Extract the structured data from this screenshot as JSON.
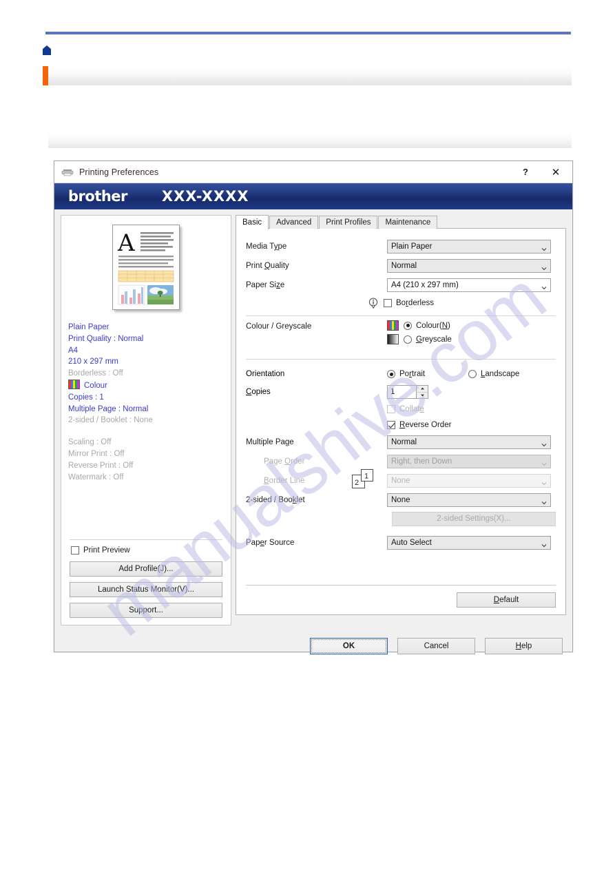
{
  "page": {
    "watermark": "manualshive.com",
    "home_icon": "home-icon"
  },
  "dialog": {
    "title": "Printing Preferences",
    "title_icon": "printer-icon",
    "help_btn": "?",
    "close_btn": "✕",
    "brand": "brother",
    "model": "XXX-XXXX"
  },
  "preview": {
    "summary": [
      {
        "text": "Plain Paper",
        "dim": false
      },
      {
        "text": "Print Quality : Normal",
        "dim": false
      },
      {
        "text": "A4",
        "dim": false
      },
      {
        "text": "210 x 297 mm",
        "dim": false
      },
      {
        "text": "Borderless : Off",
        "dim": true
      },
      {
        "text": "Colour",
        "dim": false,
        "swatch": true
      },
      {
        "text": "Copies : 1",
        "dim": false
      },
      {
        "text": "Multiple Page : Normal",
        "dim": false
      },
      {
        "text": "2-sided / Booklet : None",
        "dim": true
      },
      {
        "text": "",
        "dim": true,
        "gap": true
      },
      {
        "text": "Scaling : Off",
        "dim": true
      },
      {
        "text": "Mirror Print : Off",
        "dim": true
      },
      {
        "text": "Reverse Print : Off",
        "dim": true
      },
      {
        "text": "Watermark : Off",
        "dim": true
      }
    ],
    "print_preview_label": "Print Preview",
    "print_preview_checked": false,
    "buttons": [
      "Add Profile(J)...",
      "Launch Status Monitor(V)...",
      "Support..."
    ]
  },
  "tabs": [
    {
      "label": "Basic",
      "active": true
    },
    {
      "label": "Advanced",
      "active": false
    },
    {
      "label": "Print Profiles",
      "active": false
    },
    {
      "label": "Maintenance",
      "active": false
    }
  ],
  "basic": {
    "media_type": {
      "label": "Media Type",
      "value": "Plain Paper"
    },
    "print_quality": {
      "label": "Print Quality",
      "value": "Normal"
    },
    "paper_size": {
      "label": "Paper Size",
      "value": "A4 (210 x 297 mm)"
    },
    "borderless": {
      "label": "Borderless",
      "checked": false,
      "icon": "info-icon"
    },
    "colour_greyscale": {
      "label": "Colour / Greyscale",
      "colour": "Colour(N)",
      "greyscale": "Greyscale",
      "selected": "colour"
    },
    "orientation": {
      "label": "Orientation",
      "portrait": "Portrait",
      "landscape": "Landscape",
      "selected": "portrait"
    },
    "copies": {
      "label": "Copies",
      "value": "1"
    },
    "collate": {
      "label": "Collate",
      "checked": false,
      "disabled": true
    },
    "reverse_order": {
      "label": "Reverse Order",
      "checked": true
    },
    "page_order_icon": {
      "back": "2",
      "front": "1"
    },
    "multiple_page": {
      "label": "Multiple Page",
      "value": "Normal"
    },
    "page_order": {
      "label": "Page Order",
      "value": "Right, then Down",
      "disabled": true
    },
    "border_line": {
      "label": "Border Line",
      "value": "None",
      "disabled": true
    },
    "two_sided_booklet": {
      "label": "2-sided / Booklet",
      "value": "None"
    },
    "two_sided_settings_btn": {
      "label": "2-sided Settings(X)...",
      "disabled": true
    },
    "paper_source": {
      "label": "Paper Source",
      "value": "Auto Select"
    },
    "default_btn": "Default"
  },
  "footer": {
    "ok": "OK",
    "cancel": "Cancel",
    "help": "Help"
  },
  "colors": {
    "brand_blue": "#22397f",
    "summary_text": "#3a3ad0",
    "accent_orange": "#f3650a",
    "rule_blue": "#5b73c4",
    "watermark": "#b9bce4"
  }
}
